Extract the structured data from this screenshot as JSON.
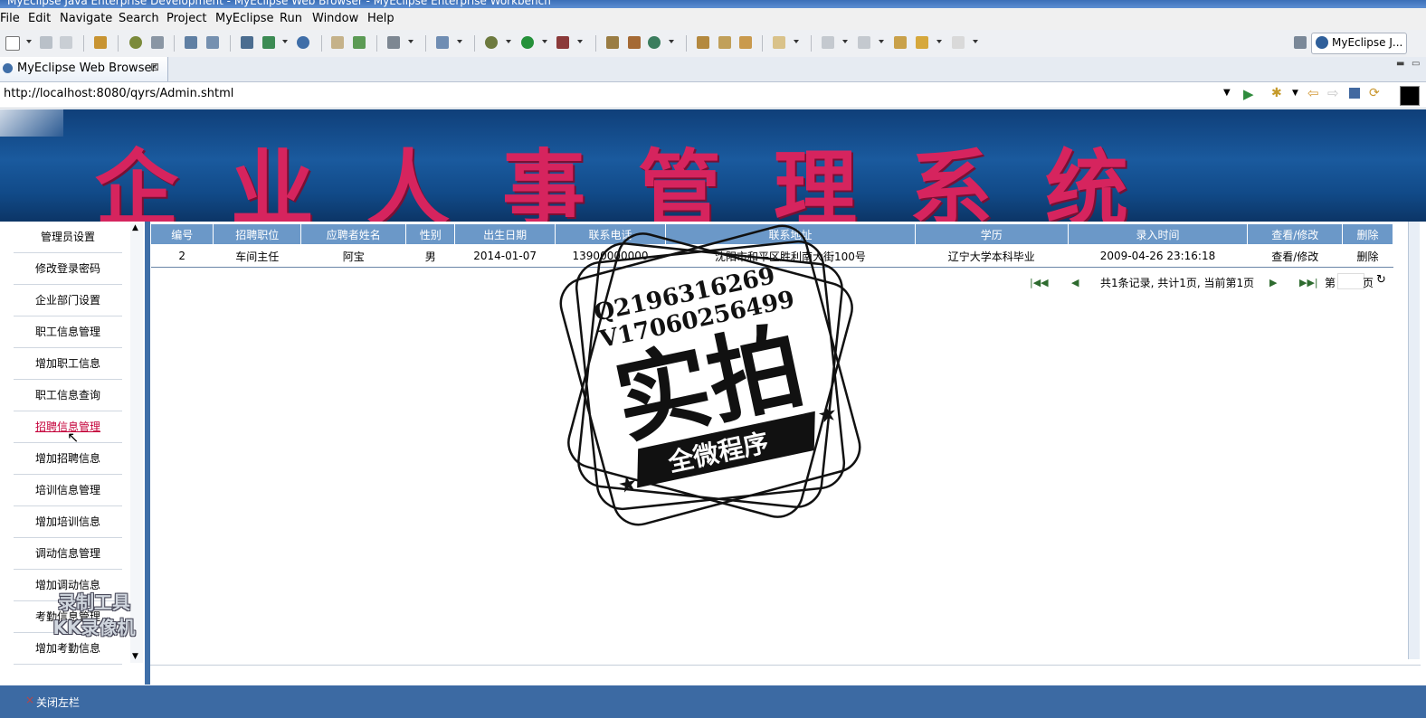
{
  "window": {
    "title": "MyEclipse Java Enterprise Development - MyEclipse Web Browser - MyEclipse Enterprise Workbench"
  },
  "menu": [
    "File",
    "Edit",
    "Navigate",
    "Search",
    "Project",
    "MyEclipse",
    "Run",
    "Window",
    "Help"
  ],
  "perspective": {
    "label": "MyEclipse J..."
  },
  "tab": {
    "label": "MyEclipse Web Browser"
  },
  "url": {
    "value": "http://localhost:8080/qyrs/Admin.shtml"
  },
  "banner": {
    "title": "企业人事管理系统"
  },
  "sidebar": {
    "items": [
      "管理员设置",
      "修改登录密码",
      "企业部门设置",
      "职工信息管理",
      "增加职工信息",
      "职工信息查询",
      "招聘信息管理",
      "增加招聘信息",
      "培训信息管理",
      "增加培训信息",
      "调动信息管理",
      "增加调动信息",
      "考勤信息管理",
      "增加考勤信息"
    ]
  },
  "grid": {
    "headers": [
      "编号",
      "招聘职位",
      "应聘者姓名",
      "性别",
      "出生日期",
      "联系电话",
      "联系地址",
      "学历",
      "录入时间",
      "查看/修改",
      "删除"
    ],
    "rows": [
      [
        "2",
        "车间主任",
        "阿宝",
        "男",
        "2014-01-07",
        "13900000000",
        "沈阳市和平区胜利南大街100号",
        "辽宁大学本科毕业",
        "2009-04-26 23:16:18",
        "查看/修改",
        "删除"
      ]
    ]
  },
  "pager": {
    "summary": "共1条记录, 共计1页, 当前第1页",
    "page_prefix": "第",
    "page_suffix": "页"
  },
  "footer": {
    "label": "关闭左栏"
  },
  "watermark": {
    "line1": "Q2196316269",
    "line2": "V17060256499",
    "main": "实拍",
    "ribbon": "全微程序"
  },
  "recorder": {
    "line1": "录制工具",
    "line2": "KK录像机"
  },
  "colors": {
    "banner_text": "#d6245e",
    "header_bg": "#6b98c8",
    "footer_bg": "#3c6aa3"
  }
}
